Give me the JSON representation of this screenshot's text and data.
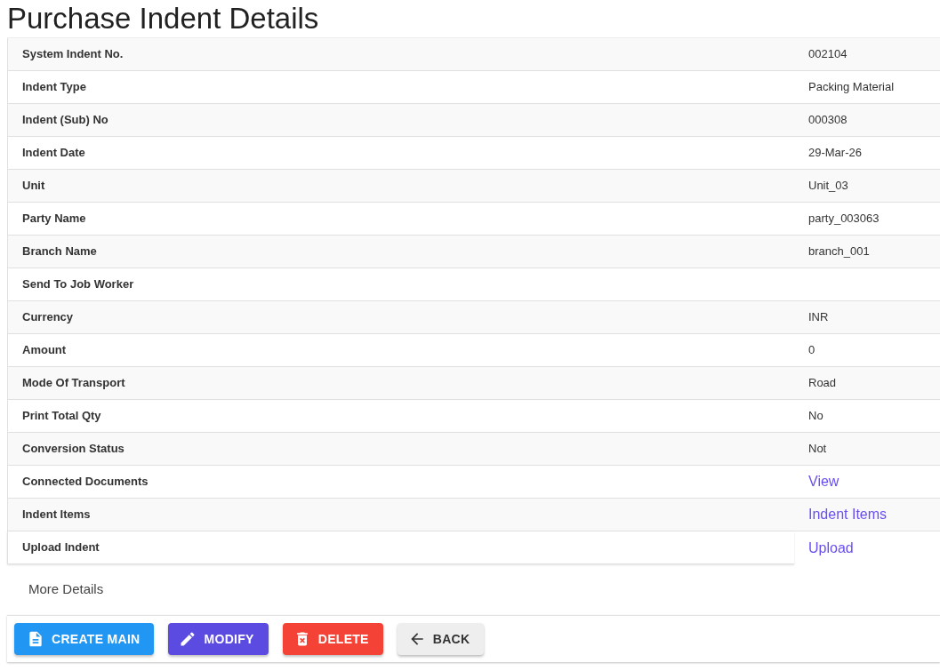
{
  "title": "Purchase Indent Details",
  "details": {
    "rows": [
      {
        "label": "System Indent No.",
        "value": "002104",
        "kind": "text"
      },
      {
        "label": "Indent Type",
        "value": "Packing Material",
        "kind": "text"
      },
      {
        "label": "Indent (Sub) No",
        "value": "000308",
        "kind": "text"
      },
      {
        "label": "Indent Date",
        "value": "29-Mar-26",
        "kind": "text"
      },
      {
        "label": "Unit",
        "value": "Unit_03",
        "kind": "text"
      },
      {
        "label": "Party Name",
        "value": "party_003063",
        "kind": "text"
      },
      {
        "label": "Branch Name",
        "value": "branch_001",
        "kind": "text"
      },
      {
        "label": "Send To Job Worker",
        "kind": "text"
      },
      {
        "label": "Currency",
        "value": "INR",
        "kind": "text"
      },
      {
        "label": "Amount",
        "value": "0",
        "kind": "text"
      },
      {
        "label": "Mode Of Transport",
        "value": "Road",
        "kind": "text"
      },
      {
        "label": "Print Total Qty",
        "value": "No",
        "kind": "text"
      },
      {
        "label": "Conversion Status",
        "value": "Not",
        "kind": "text"
      },
      {
        "label": "Connected Documents",
        "value": "View",
        "kind": "link"
      },
      {
        "label": "Indent Items",
        "value": "Indent Items",
        "kind": "link"
      },
      {
        "label": "Upload Indent",
        "value": "Upload",
        "kind": "link"
      }
    ]
  },
  "more_details": "More Details",
  "actions": [
    {
      "label": "CREATE MAIN",
      "kind": "create"
    },
    {
      "label": "MODIFY",
      "kind": "modify"
    },
    {
      "label": "DELETE",
      "kind": "delete"
    },
    {
      "label": "BACK",
      "kind": "back"
    }
  ]
}
